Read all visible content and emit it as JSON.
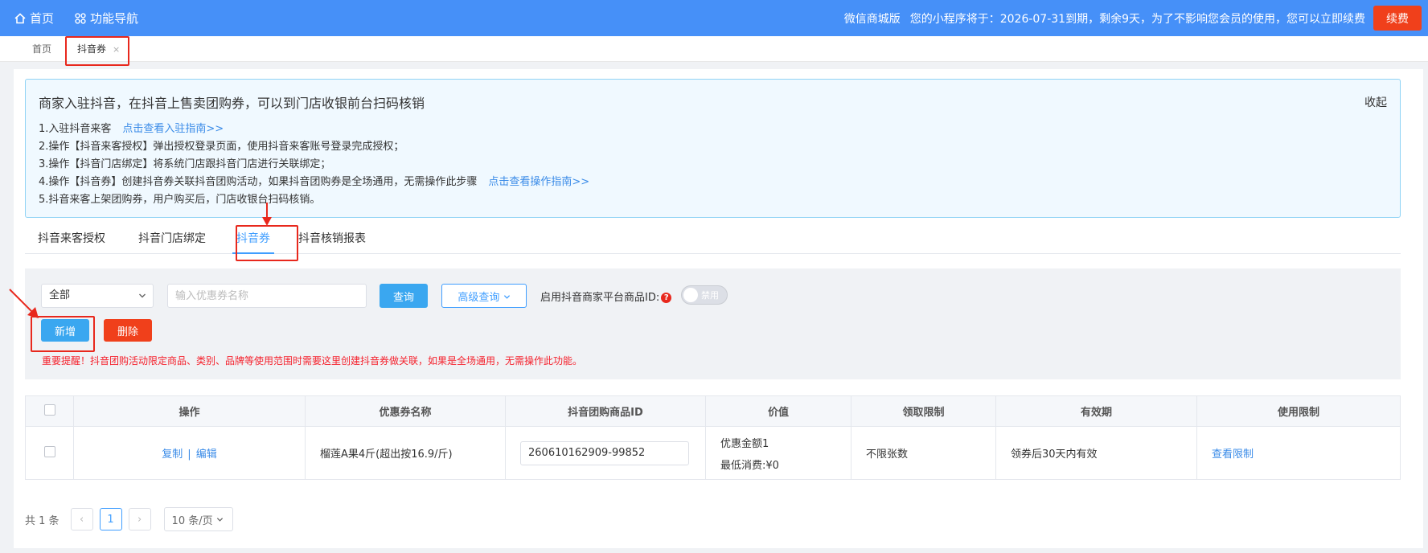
{
  "topbar": {
    "home": "首页",
    "nav": "功能导航",
    "edition": "微信商城版",
    "notice": "您的小程序将于：2026-07-31到期，剩余9天，为了不影响您会员的使用，您可以立即续费",
    "renew": "续费"
  },
  "tags": {
    "home": "首页",
    "active": "抖音券",
    "close": "×"
  },
  "info": {
    "title": "商家入驻抖音，在抖音上售卖团购券，可以到门店收银前台扫码核销",
    "collapse": "收起",
    "lines": [
      {
        "text": "1.入驻抖音来客",
        "link": "点击查看入驻指南>>"
      },
      {
        "text": "2.操作【抖音来客授权】弹出授权登录页面，使用抖音来客账号登录完成授权；",
        "link": ""
      },
      {
        "text": "3.操作【抖音门店绑定】将系统门店跟抖音门店进行关联绑定；",
        "link": ""
      },
      {
        "text": "4.操作【抖音券】创建抖音券关联抖音团购活动，如果抖音团购券是全场通用，无需操作此步骤",
        "link": "点击查看操作指南>>"
      },
      {
        "text": "5.抖音来客上架团购券，用户购买后，门店收银台扫码核销。",
        "link": ""
      }
    ]
  },
  "tabs": [
    "抖音来客授权",
    "抖音门店绑定",
    "抖音券",
    "抖音核销报表"
  ],
  "filter": {
    "select": "全部",
    "search_placeholder": "输入优惠券名称",
    "query": "查询",
    "advanced": "高级查询",
    "switch_label": "启用抖音商家平台商品ID:",
    "help": "?",
    "switch_text": "禁用",
    "add": "新增",
    "delete": "删除",
    "warning": "重要提醒！抖音团购活动限定商品、类别、品牌等使用范围时需要这里创建抖音券做关联，如果是全场通用，无需操作此功能。"
  },
  "table": {
    "headers": [
      "操作",
      "优惠券名称",
      "抖音团购商品ID",
      "价值",
      "领取限制",
      "有效期",
      "使用限制"
    ],
    "row": {
      "copy": "复制",
      "sep": "|",
      "edit": "编辑",
      "name": "榴莲A果4斤(超出按16.9/斤)",
      "id": "260610162909-99852",
      "value1": "优惠金额1",
      "value2": "最低消费:¥0",
      "limit": "不限张数",
      "validity": "领券后30天内有效",
      "usage": "查看限制"
    }
  },
  "pager": {
    "total": "共 1 条",
    "prev": "‹",
    "page": "1",
    "next": "›",
    "size": "10 条/页"
  }
}
